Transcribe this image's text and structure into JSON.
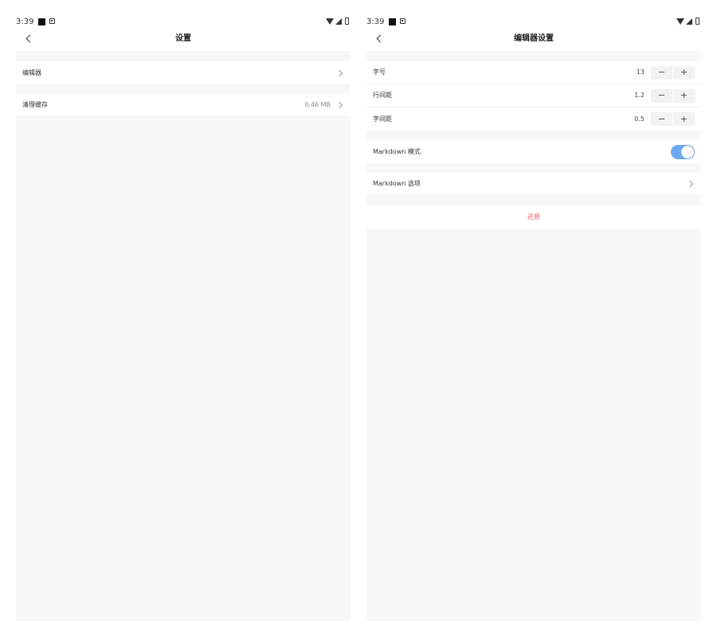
{
  "status_bar": {
    "time": "3:39"
  },
  "left": {
    "title": "设置",
    "items": [
      {
        "label": "编辑器"
      },
      {
        "label": "清理缓存",
        "value": "0.46 MB"
      }
    ]
  },
  "right": {
    "title": "编辑器设置",
    "steppers": [
      {
        "label": "字号",
        "value": "13",
        "minus": "−",
        "plus": "+"
      },
      {
        "label": "行间距",
        "value": "1.2",
        "minus": "−",
        "plus": "+"
      },
      {
        "label": "字间距",
        "value": "0.5",
        "minus": "−",
        "plus": "+"
      }
    ],
    "markdown_mode": {
      "label": "Markdown 模式",
      "enabled": true
    },
    "markdown_options": {
      "label": "Markdown 选项"
    },
    "reset_label": "还原"
  },
  "colors": {
    "accent": "#6ea8f0",
    "danger": "#f05a5a",
    "background": "#f7f7f7"
  }
}
